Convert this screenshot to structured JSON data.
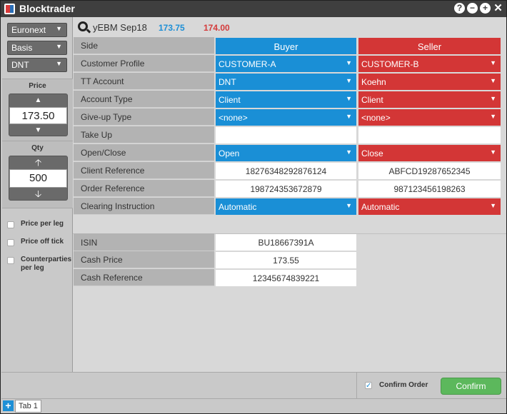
{
  "window": {
    "title": "Blocktrader",
    "buttons": [
      "?",
      "−",
      "+",
      "✕"
    ]
  },
  "left": {
    "exchange": "Euronext",
    "type": "Basis",
    "account": "DNT",
    "price_label": "Price",
    "price_value": "173.50",
    "qty_label": "Qty",
    "qty_value": "500",
    "checkboxes": [
      "Price per leg",
      "Price off tick",
      "Counterparties per leg"
    ]
  },
  "instrument": {
    "name": "yEBM Sep18",
    "bid": "173.75",
    "ask": "174.00"
  },
  "grid": {
    "side_label": "Side",
    "buyer_header": "Buyer",
    "seller_header": "Seller",
    "rows": [
      {
        "label": "Customer Profile",
        "buyer": "CUSTOMER-A",
        "seller": "CUSTOMER-B"
      },
      {
        "label": "TT Account",
        "buyer": "DNT",
        "seller": "Koehn"
      },
      {
        "label": "Account Type",
        "buyer": "Client",
        "seller": "Client"
      },
      {
        "label": "Give-up Type",
        "buyer": "<none>",
        "seller": "<none>"
      },
      {
        "label": "Take Up",
        "buyer": "",
        "seller": ""
      },
      {
        "label": "Open/Close",
        "buyer": "Open",
        "seller": "Close"
      },
      {
        "label": "Client Reference",
        "buyer": "18276348292876124",
        "seller": "ABFCD19287652345"
      },
      {
        "label": "Order Reference",
        "buyer": "198724353672879",
        "seller": "987123456198263"
      },
      {
        "label": "Clearing Instruction",
        "buyer": "Automatic",
        "seller": "Automatic"
      }
    ],
    "extra": [
      {
        "label": "ISIN",
        "value": "BU18667391A"
      },
      {
        "label": "Cash Price",
        "value": "173.55"
      },
      {
        "label": "Cash Reference",
        "value": "12345674839221"
      }
    ]
  },
  "footer": {
    "confirm_order_label": "Confirm Order",
    "confirm_button": "Confirm",
    "tab_label": "Tab 1"
  },
  "colors": {
    "buyer": "#1a8fd6",
    "seller": "#d33636",
    "confirm": "#5cb85c"
  }
}
